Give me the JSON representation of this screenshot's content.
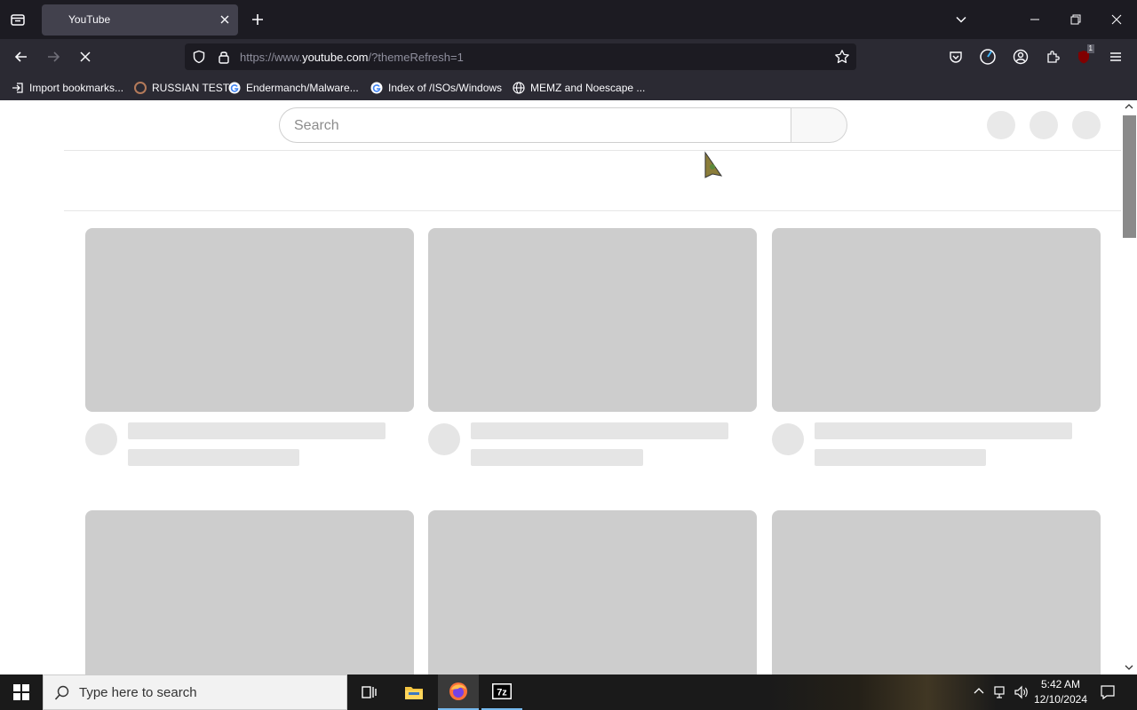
{
  "browser": {
    "tab": {
      "title": "YouTube"
    },
    "url": {
      "prefix": "https://www.",
      "domain": "youtube.com",
      "suffix": "/?themeRefresh=1"
    },
    "bookmarks": [
      {
        "label": "Import bookmarks...",
        "icon": "import-icon"
      },
      {
        "label": "RUSSIAN TEST",
        "icon": "site-icon"
      },
      {
        "label": "Endermanch/Malware...",
        "icon": "google-icon"
      },
      {
        "label": "Index of /ISOs/Windows",
        "icon": "google-icon"
      },
      {
        "label": "MEMZ and Noescape ...",
        "icon": "globe-icon"
      }
    ],
    "extension_badge": "1"
  },
  "page": {
    "search": {
      "placeholder": "Search"
    }
  },
  "taskbar": {
    "search_placeholder": "Type here to search",
    "time": "5:42 AM",
    "date": "12/10/2024"
  },
  "colors": {
    "tabstrip": "#1c1b22",
    "toolbar": "#2b2a33",
    "skeleton_thumb": "#cdcdcd",
    "skeleton_line": "#e5e5e5"
  }
}
